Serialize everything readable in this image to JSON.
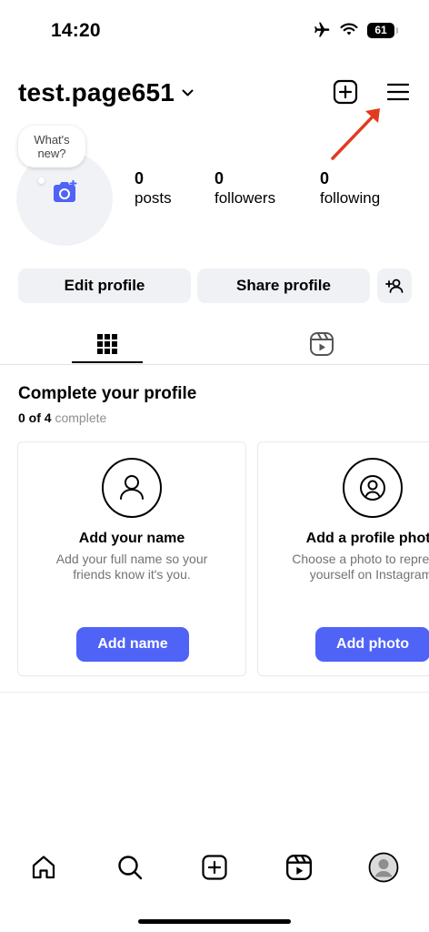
{
  "status_bar": {
    "time": "14:20",
    "battery": "61"
  },
  "header": {
    "username": "test.page651"
  },
  "profile": {
    "bubble_text": "What's new?",
    "stats": [
      {
        "count": "0",
        "label": "posts"
      },
      {
        "count": "0",
        "label": "followers"
      },
      {
        "count": "0",
        "label": "following"
      }
    ]
  },
  "actions": {
    "edit_label": "Edit profile",
    "share_label": "Share profile"
  },
  "complete_profile": {
    "title": "Complete your profile",
    "progress_count": "0 of 4",
    "progress_suffix": "complete",
    "cards": [
      {
        "title": "Add your name",
        "desc_line1": "Add your full name so your",
        "desc_line2": "friends know it's you.",
        "button": "Add name"
      },
      {
        "title": "Add a profile photo",
        "desc_line1": "Choose a photo to represent",
        "desc_line2": "yourself on Instagram.",
        "button": "Add photo"
      }
    ]
  },
  "colors": {
    "accent": "#4f63f7",
    "annotation": "#e23a1f",
    "button_bg": "#eff1f4"
  }
}
